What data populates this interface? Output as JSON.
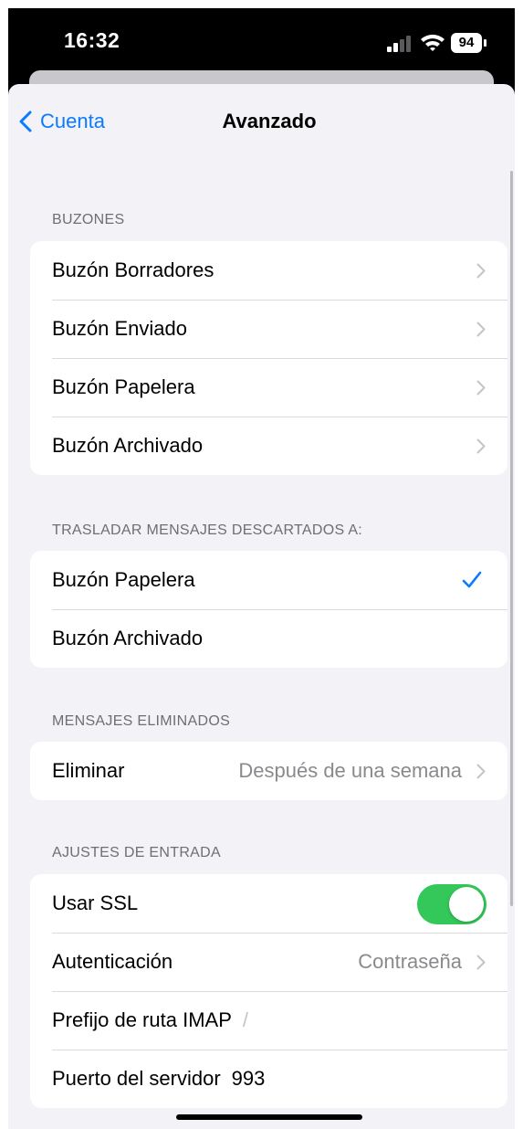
{
  "status_bar": {
    "time": "16:32",
    "battery": "94",
    "signal_icon": "cellular-signal-icon",
    "wifi_icon": "wifi-icon"
  },
  "nav": {
    "back_label": "Cuenta",
    "title": "Avanzado"
  },
  "sections": {
    "mailboxes": {
      "header": "BUZONES",
      "items": [
        {
          "label": "Buzón Borradores"
        },
        {
          "label": "Buzón Enviado"
        },
        {
          "label": "Buzón Papelera"
        },
        {
          "label": "Buzón Archivado"
        }
      ]
    },
    "move_discarded": {
      "header": "TRASLADAR MENSAJES DESCARTADOS A:",
      "items": [
        {
          "label": "Buzón Papelera",
          "selected": true
        },
        {
          "label": "Buzón Archivado",
          "selected": false
        }
      ]
    },
    "deleted_messages": {
      "header": "MENSAJES ELIMINADOS",
      "remove_label": "Eliminar",
      "remove_value": "Después de una semana"
    },
    "incoming_settings": {
      "header": "AJUSTES DE ENTRADA",
      "use_ssl_label": "Usar SSL",
      "use_ssl_on": true,
      "auth_label": "Autenticación",
      "auth_value": "Contraseña",
      "imap_prefix_label": "Prefijo de ruta IMAP",
      "imap_prefix_placeholder": "/",
      "server_port_label": "Puerto del servidor",
      "server_port_value": "993"
    }
  },
  "colors": {
    "accent": "#0a7aff",
    "toggle_on": "#34c759",
    "background": "#f2f2f7"
  }
}
